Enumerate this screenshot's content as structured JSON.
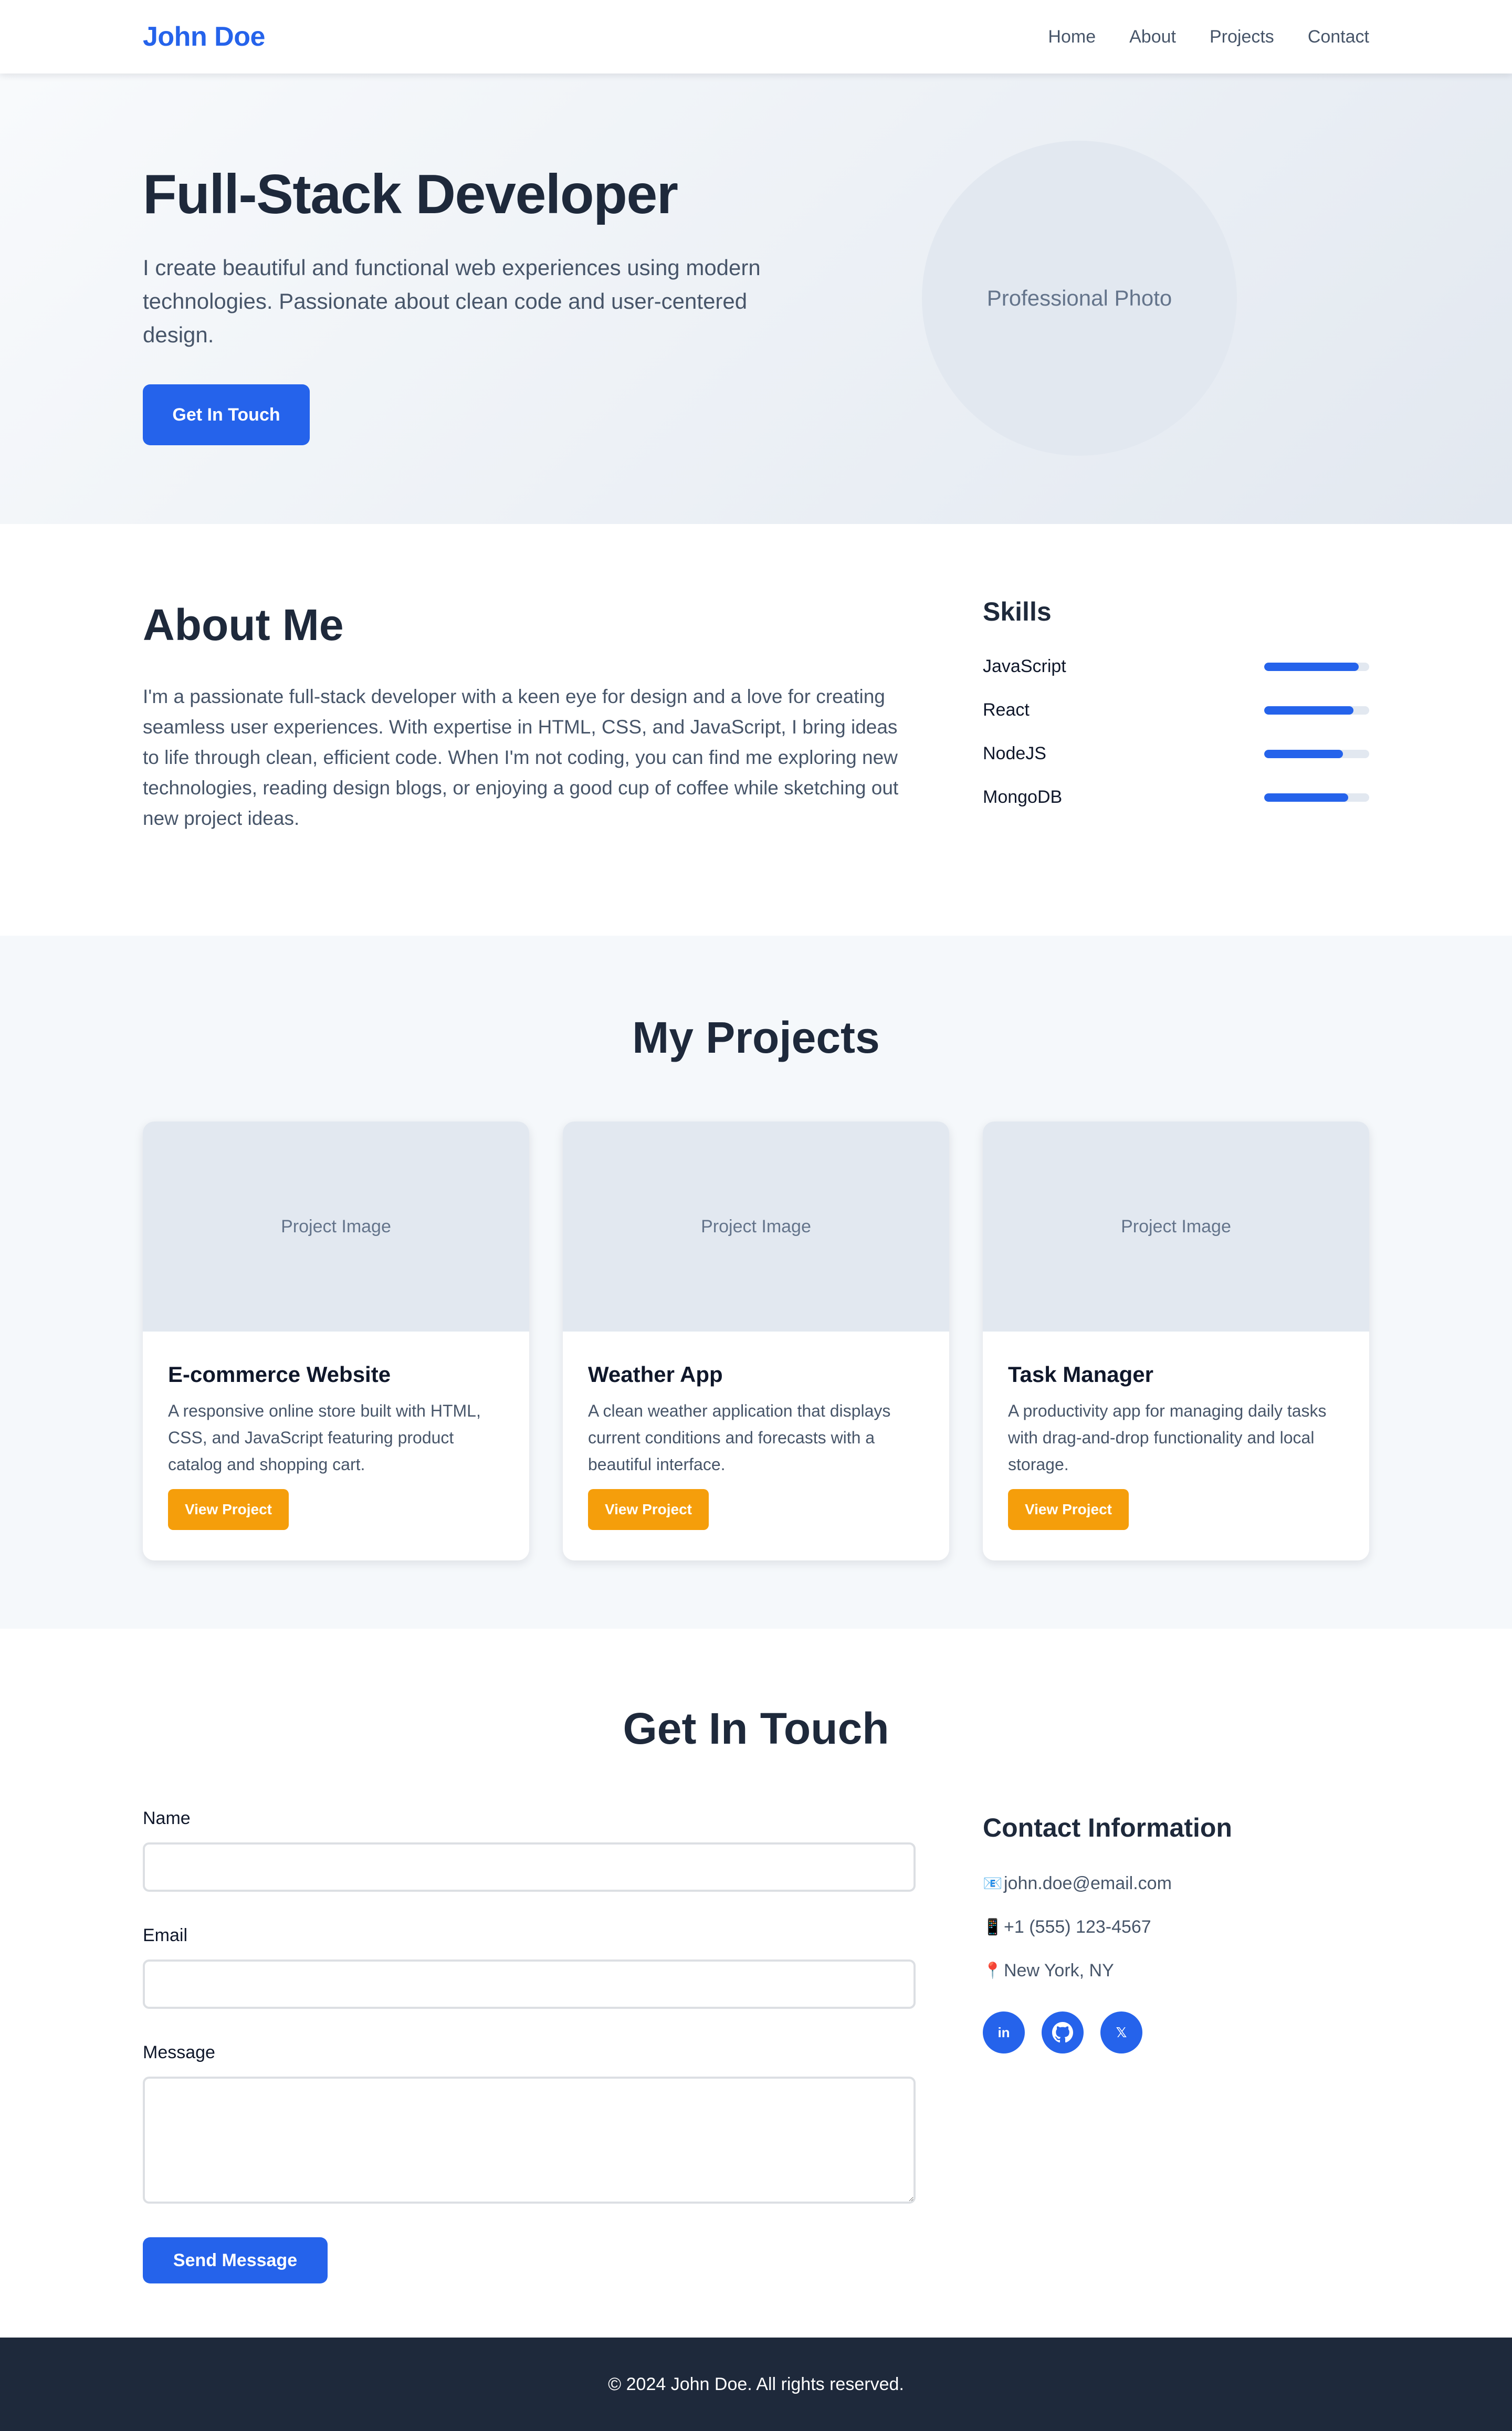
{
  "nav": {
    "brand": "John Doe",
    "links": [
      "Home",
      "About",
      "Projects",
      "Contact"
    ]
  },
  "hero": {
    "title": "Full-Stack Developer",
    "subtitle": "I create beautiful and functional web experiences using modern technologies. Passionate about clean code and user-centered design.",
    "cta": "Get In Touch",
    "photo_label": "Professional Photo"
  },
  "about": {
    "title": "About Me",
    "text": "I'm a passionate full-stack developer with a keen eye for design and a love for creating seamless user experiences. With expertise in HTML, CSS, and JavaScript, I bring ideas to life through clean, efficient code. When I'm not coding, you can find me exploring new technologies, reading design blogs, or enjoying a good cup of coffee while sketching out new project ideas.",
    "skills_title": "Skills",
    "skills": [
      {
        "name": "JavaScript",
        "level": 0.9
      },
      {
        "name": "React",
        "level": 0.85
      },
      {
        "name": "NodeJS",
        "level": 0.75
      },
      {
        "name": "MongoDB",
        "level": 0.8
      }
    ]
  },
  "projects": {
    "title": "My Projects",
    "image_label": "Project Image",
    "button_label": "View Project",
    "items": [
      {
        "title": "E-commerce Website",
        "desc": "A responsive online store built with HTML, CSS, and JavaScript featuring product catalog and shopping cart."
      },
      {
        "title": "Weather App",
        "desc": "A clean weather application that displays current conditions and forecasts with a beautiful interface."
      },
      {
        "title": "Task Manager",
        "desc": "A productivity app for managing daily tasks with drag-and-drop functionality and local storage."
      }
    ]
  },
  "contact": {
    "title": "Get In Touch",
    "form": {
      "name_label": "Name",
      "email_label": "Email",
      "message_label": "Message",
      "name_value": "",
      "email_value": "",
      "message_value": "",
      "submit": "Send Message"
    },
    "info_title": "Contact Information",
    "info": [
      {
        "icon": "📧",
        "icon_name": "email-icon",
        "text": "john.doe@email.com"
      },
      {
        "icon": "📱",
        "icon_name": "phone-icon",
        "text": "+1 (555) 123-4567"
      },
      {
        "icon": "📍",
        "icon_name": "location-pin-icon",
        "text": "New York, NY"
      }
    ],
    "socials": [
      {
        "name": "linkedin-icon",
        "glyph": "in"
      },
      {
        "name": "github-icon",
        "glyph": "gh"
      },
      {
        "name": "x-twitter-icon",
        "glyph": "𝕏"
      }
    ]
  },
  "footer": {
    "text": "© 2024 John Doe. All rights reserved."
  },
  "colors": {
    "primary": "#2563eb",
    "accent": "#f59e0b",
    "dark": "#1e293b",
    "muted": "#475569"
  }
}
